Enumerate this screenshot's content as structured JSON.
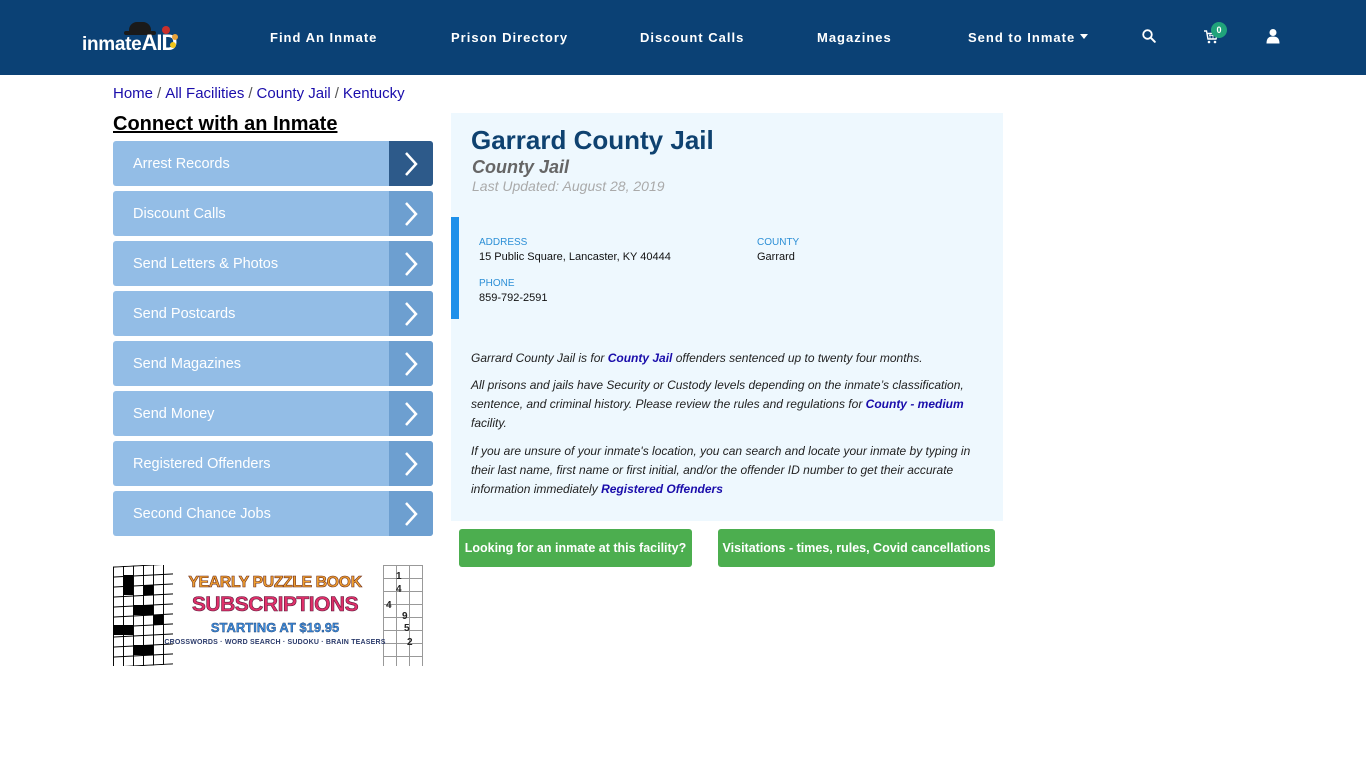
{
  "header": {
    "logo": {
      "text_main": "inmate",
      "text_accent": "AID"
    },
    "nav": [
      {
        "label": "Find An Inmate"
      },
      {
        "label": "Prison Directory"
      },
      {
        "label": "Discount Calls"
      },
      {
        "label": "Magazines"
      },
      {
        "label": "Send to Inmate",
        "has_dropdown": true
      }
    ],
    "icons": {
      "search": "search-icon",
      "cart": "cart-icon",
      "user": "user-icon"
    },
    "cart_count": "0"
  },
  "breadcrumb": [
    {
      "label": "Home"
    },
    {
      "label": "All Facilities"
    },
    {
      "label": "County Jail"
    },
    {
      "label": "Kentucky"
    }
  ],
  "sidebar": {
    "title": "Connect with an Inmate",
    "items": [
      {
        "label": "Arrest Records",
        "active": true
      },
      {
        "label": "Discount Calls"
      },
      {
        "label": "Send Letters & Photos"
      },
      {
        "label": "Send Postcards"
      },
      {
        "label": "Send Magazines"
      },
      {
        "label": "Send Money"
      },
      {
        "label": "Registered Offenders"
      },
      {
        "label": "Second Chance Jobs"
      }
    ]
  },
  "ad": {
    "line1": "YEARLY PUZZLE BOOK",
    "line2": "SUBSCRIPTIONS",
    "line3": "STARTING AT $19.95",
    "line4": "CROSSWORDS · WORD SEARCH · SUDOKU · BRAIN TEASERS",
    "sudoku_digits": [
      "1",
      "4",
      "4",
      "9",
      "5",
      "2"
    ]
  },
  "facility": {
    "name": "Garrard County Jail",
    "type": "County Jail",
    "last_updated": "Last Updated: August 28, 2019",
    "address_label": "ADDRESS",
    "address": "15 Public Square, Lancaster, KY 40444",
    "county_label": "COUNTY",
    "county": "Garrard",
    "phone_label": "PHONE",
    "phone": "859-792-2591"
  },
  "description": {
    "p1_pre": "Garrard County Jail is for ",
    "p1_link": "County Jail",
    "p1_post": " offenders sentenced up to twenty four months.",
    "p2_pre": "All prisons and jails have Security or Custody levels depending on the inmate’s classification, sentence, and criminal history. Please review the rules and regulations for ",
    "p2_link": "County - medium",
    "p2_post": " facility.",
    "p3_pre": "If you are unsure of your inmate's location, you can search and locate your inmate by typing in their last name, first name or first initial, and/or the offender ID number to get their accurate information immediately ",
    "p3_link": "Registered Offenders"
  },
  "actions": {
    "find_inmate": "Looking for an inmate at this facility?",
    "visitations": "Visitations - times, rules, Covid cancellations"
  },
  "colors": {
    "header_bg": "#0b4175",
    "sidebar_item": "#93bde6",
    "sidebar_arrow": "#6d9fd0",
    "sidebar_arrow_active": "#2d5a8a",
    "panel_bg": "#eef8fe",
    "accent_blue": "#1e90ea",
    "button_green": "#4cae4f",
    "link": "#1a0dab"
  }
}
